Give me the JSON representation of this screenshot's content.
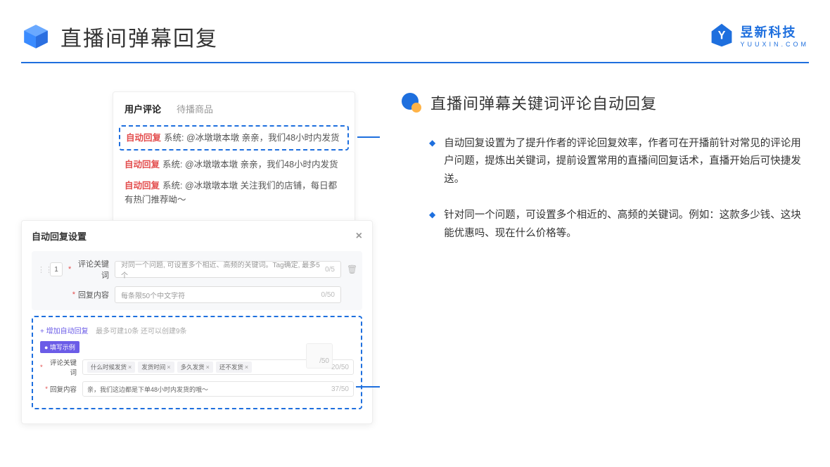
{
  "header": {
    "title": "直播间弹幕回复",
    "brand_name": "昱新科技",
    "brand_sub": "YUUXIN.COM"
  },
  "comments": {
    "tabs": [
      "用户评论",
      "待播商品"
    ],
    "active_tab": 0,
    "items": [
      {
        "tag": "自动回复",
        "sys": "系统:",
        "text": "@冰墩墩本墩 亲亲，我们48小时内发货"
      },
      {
        "tag": "自动回复",
        "sys": "系统:",
        "text": "@冰墩墩本墩 亲亲，我们48小时内发货"
      },
      {
        "tag": "自动回复",
        "sys": "系统:",
        "text": "@冰墩墩本墩 关注我们的店铺，每日都有热门推荐呦～"
      }
    ]
  },
  "settings": {
    "title": "自动回复设置",
    "order": "1",
    "keyword_label": "评论关键词",
    "keyword_placeholder": "对同一个问题, 可设置多个相近、高频的关键词。Tag确定, 最多5个",
    "keyword_count": "0/5",
    "content_label": "回复内容",
    "content_placeholder": "每条限50个中文字符",
    "content_count": "0/50",
    "add_link": "+ 增加自动回复",
    "hint": "最多可建10条 还可以创建9条",
    "example_badge": "● 填写示例",
    "ex_keyword_label": "评论关键词",
    "ex_tags": [
      "什么时候发货",
      "发货时间",
      "多久发货",
      "还不发货"
    ],
    "ex_keyword_count": "20/50",
    "ex_content_label": "回复内容",
    "ex_content_text": "亲，我们这边都是下单48小时内发货的哦～",
    "ex_content_count": "37/50",
    "stray_count": "/50"
  },
  "right": {
    "section_title": "直播间弹幕关键词评论自动回复",
    "bullets": [
      "自动回复设置为了提升作者的评论回复效率，作者可在开播前针对常见的评论用户问题，提炼出关键词，提前设置常用的直播间回复话术，直播开始后可快捷发送。",
      "针对同一个问题，可设置多个相近的、高频的关键词。例如：这款多少钱、这块能优惠吗、现在什么价格等。"
    ]
  }
}
